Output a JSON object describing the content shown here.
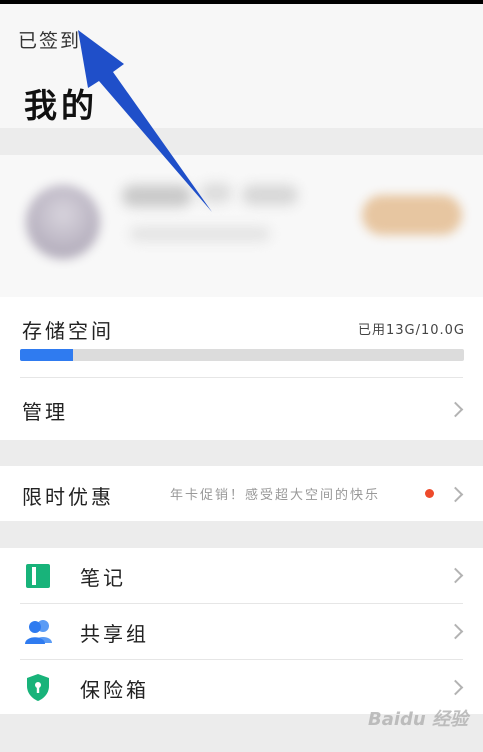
{
  "header": {
    "signin_label": "已签到",
    "title": "我的"
  },
  "storage": {
    "label": "存储空间",
    "used_text": "已用13G/10.0G",
    "fill_fraction": 0.12,
    "bar_color": "#2f7bf0"
  },
  "manage": {
    "label": "管理"
  },
  "promo": {
    "label": "限时优惠",
    "text": "年卡促销！感受超大空间的快乐",
    "dot_color": "#ee4a2b"
  },
  "features": [
    {
      "label": "笔记",
      "icon": "notebook-icon",
      "color": "#18b37a"
    },
    {
      "label": "共享组",
      "icon": "group-icon",
      "color": "#2f7bf0"
    },
    {
      "label": "保险箱",
      "icon": "shield-lock-icon",
      "color": "#18b37a"
    }
  ],
  "watermark": "Baidu 经验",
  "annotation_arrow_color": "#1f4fc9"
}
